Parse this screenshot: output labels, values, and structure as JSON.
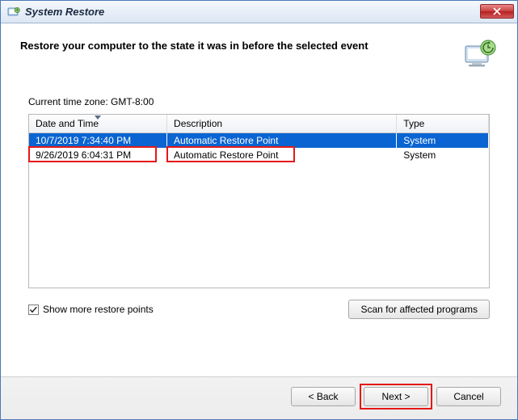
{
  "window": {
    "title": "System Restore"
  },
  "header": {
    "headline": "Restore your computer to the state it was in before the selected event"
  },
  "timezone_label": "Current time zone: GMT-8:00",
  "table": {
    "columns": {
      "date_time": "Date and Time",
      "description": "Description",
      "type": "Type"
    },
    "rows": [
      {
        "date_time": "10/7/2019 7:34:40 PM",
        "description": "Automatic Restore Point",
        "type": "System",
        "selected": true
      },
      {
        "date_time": "9/26/2019 6:04:31 PM",
        "description": "Automatic Restore Point",
        "type": "System",
        "selected": false,
        "annotated": true
      }
    ]
  },
  "options": {
    "show_more_label": "Show more restore points",
    "show_more_checked": true,
    "scan_button_label": "Scan for affected programs"
  },
  "footer": {
    "back_label": "< Back",
    "next_label": "Next >",
    "cancel_label": "Cancel"
  }
}
